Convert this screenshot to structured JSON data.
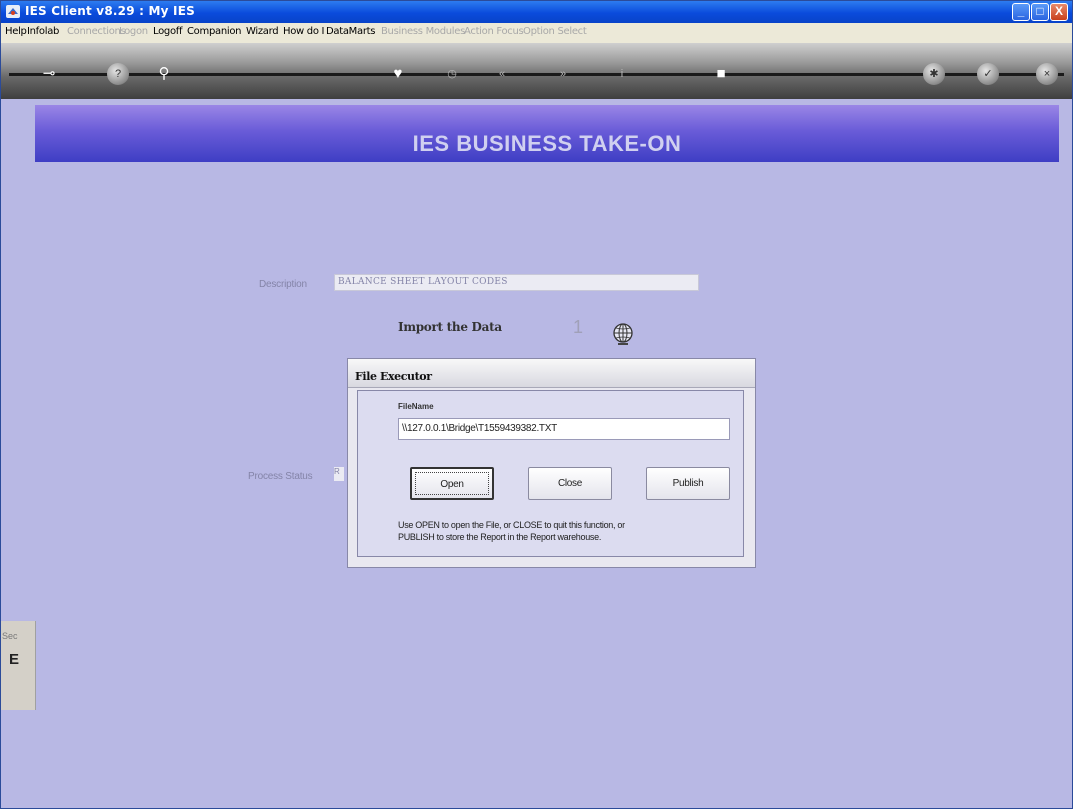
{
  "window": {
    "title": "IES Client v8.29 : My IES",
    "controls": {
      "minimize": "_",
      "maximize": "□",
      "close": "X"
    }
  },
  "menu": [
    {
      "label": "Help",
      "enabled": true
    },
    {
      "label": "Infolab",
      "enabled": true
    },
    {
      "label": "Connections",
      "enabled": false
    },
    {
      "label": "Logon",
      "enabled": false
    },
    {
      "label": "Logoff",
      "enabled": true
    },
    {
      "label": "Companion",
      "enabled": true
    },
    {
      "label": "Wizard",
      "enabled": true
    },
    {
      "label": "How do I",
      "enabled": true
    },
    {
      "label": "DataMarts",
      "enabled": true
    },
    {
      "label": "Business Modules",
      "enabled": false
    },
    {
      "label": "Action Focus",
      "enabled": false
    },
    {
      "label": "Option Select",
      "enabled": false
    }
  ],
  "toolbar": {
    "icons": [
      "key-icon",
      "help-icon",
      "search-icon",
      "heart-icon",
      "clock-icon",
      "rewind-icon",
      "fast-forward-icon",
      "info-icon",
      "stop-icon",
      "settings-icon",
      "ok-icon",
      "close-icon"
    ]
  },
  "banner": {
    "title": "IES BUSINESS TAKE-ON"
  },
  "form": {
    "description_label": "Description",
    "description_value": "BALANCE SHEET LAYOUT CODES",
    "import_label": "Import the Data",
    "import_step": "1",
    "process_status_label": "Process Status",
    "process_status_value": "R"
  },
  "dialog": {
    "title": "File Executor",
    "filename_label": "FileName",
    "filename_value": "\\\\127.0.0.1\\Bridge\\T1559439382.TXT",
    "buttons": {
      "open": "Open",
      "close": "Close",
      "publish": "Publish"
    },
    "help_line1": "Use OPEN to open the File, or CLOSE to quit this function, or",
    "help_line2": "PUBLISH to store the Report in the Report warehouse."
  },
  "side_panel": {
    "text1": "Sec",
    "text2": "E"
  }
}
